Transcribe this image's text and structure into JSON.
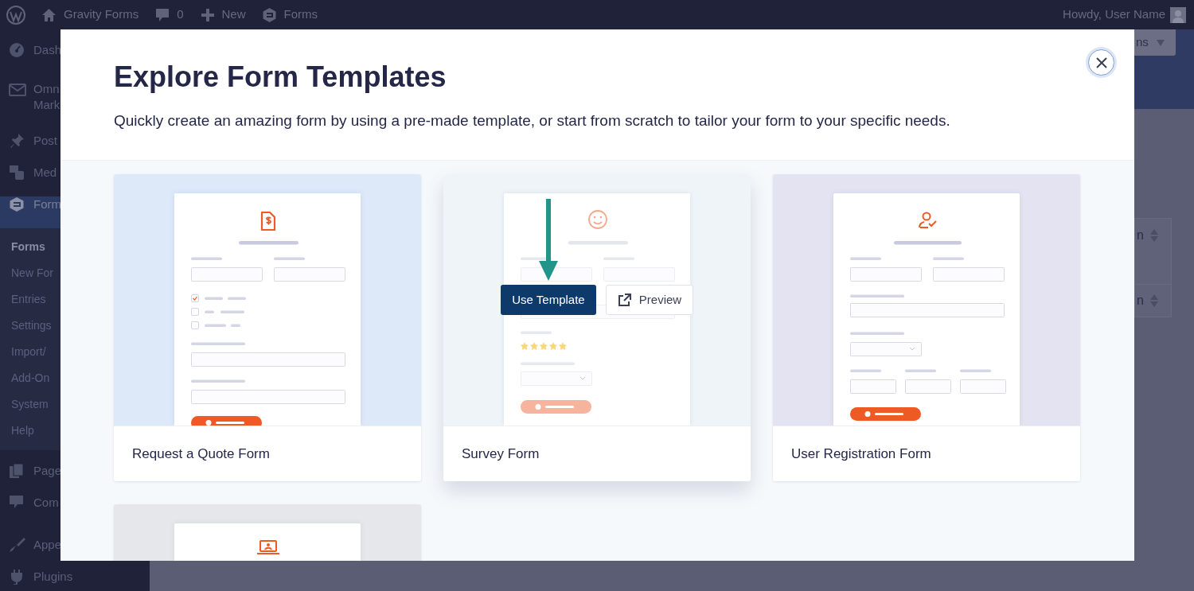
{
  "admin_bar": {
    "site": "Gravity Forms",
    "comments": "0",
    "new": "New",
    "plugin": "Forms",
    "greeting": "Howdy, User Name"
  },
  "sidebar": {
    "groups": [
      {
        "items": [
          {
            "label": "Dash",
            "selected": false
          },
          {
            "label": "Omn\nMark",
            "selected": false
          }
        ]
      },
      {
        "items": [
          {
            "label": "Post",
            "selected": false
          },
          {
            "label": "Med",
            "selected": false
          },
          {
            "label": "Form",
            "selected": true,
            "children": [
              {
                "label": "Forms",
                "selected": true
              },
              {
                "label": "New For",
                "selected": false
              },
              {
                "label": "Entries",
                "selected": false
              },
              {
                "label": "Settings",
                "selected": false
              },
              {
                "label": "Import/",
                "selected": false
              },
              {
                "label": "Add-On",
                "selected": false
              },
              {
                "label": "System",
                "selected": false
              },
              {
                "label": "Help",
                "selected": false
              }
            ]
          }
        ]
      },
      {
        "items": [
          {
            "label": "Page",
            "selected": false
          },
          {
            "label": "Com",
            "selected": false
          }
        ]
      },
      {
        "items": [
          {
            "label": "Appe",
            "selected": false
          },
          {
            "label": "Plugins",
            "selected": false
          }
        ]
      }
    ]
  },
  "background_page": {
    "action_button": "ns",
    "columns": [
      "n",
      "n"
    ]
  },
  "modal": {
    "title": "Explore Form Templates",
    "subtitle": "Quickly create an amazing form by using a pre-made template, or start from scratch to tailor your form to your specific needs.",
    "templates": [
      {
        "kind": "quote",
        "name": "Request a Quote Form",
        "hovered": false
      },
      {
        "kind": "survey",
        "name": "Survey Form",
        "hovered": true,
        "use_label": "Use Template",
        "preview_label": "Preview"
      },
      {
        "kind": "registration",
        "name": "User Registration Form",
        "hovered": false
      },
      {
        "kind": "webinar",
        "hovered": false
      }
    ]
  }
}
